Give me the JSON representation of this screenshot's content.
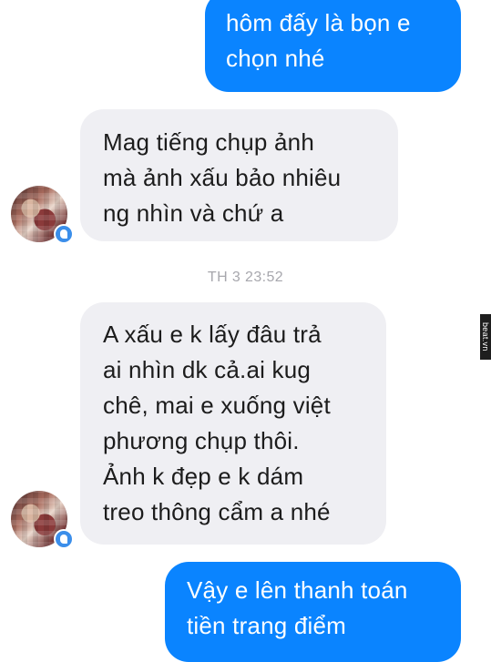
{
  "conversation": {
    "messages": [
      {
        "direction": "outgoing",
        "lines": [
          "hôm đấy là bọn e",
          "chọn nhé"
        ]
      },
      {
        "direction": "incoming",
        "lines": [
          "Mag tiếng chụp ảnh",
          "mà ảnh xấu bảo nhiêu",
          "ng nhìn và chứ a"
        ]
      },
      {
        "direction": "incoming",
        "lines": [
          "A xấu e k lấy đâu trả",
          "ai nhìn dk cả.ai kug",
          "chê, mai e xuống việt",
          "phương chụp thôi.",
          "Ảnh k đẹp e k dám",
          "treo thông cẩm a nhé"
        ]
      },
      {
        "direction": "outgoing",
        "lines": [
          "Vậy e lên thanh toán",
          "tiền trang điểm"
        ]
      }
    ],
    "timestamp": "TH 3 23:52"
  },
  "watermark": {
    "text": "beat.vn"
  },
  "colors": {
    "outgoing_bubble": "#0a84ff",
    "incoming_bubble": "#efeff3",
    "timestamp_text": "#a7a7ad"
  }
}
